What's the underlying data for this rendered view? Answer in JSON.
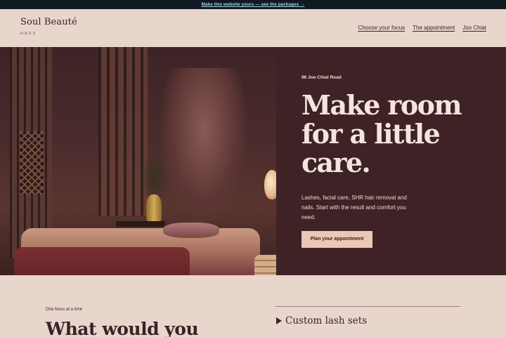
{
  "promo": {
    "text": "Make this website yours — see the packages →"
  },
  "brand": {
    "name": "Soul Beauté",
    "sub": "HAUS"
  },
  "nav": {
    "items": [
      {
        "label": "Choose your focus"
      },
      {
        "label": "The appointment"
      },
      {
        "label": "Joo Chiat"
      }
    ]
  },
  "hero": {
    "eyebrow": "96 Joo Chiat Road",
    "headline": "Make room for a little care.",
    "lede": "Lashes, facial care, SHR hair removal and nails. Start with the result and comfort you need.",
    "cta": "Plan your appointment"
  },
  "focus": {
    "eyebrow": "One focus at a time",
    "title": "What would you",
    "items": [
      {
        "label": "Custom lash sets",
        "icon": "triangle-right-icon"
      }
    ]
  },
  "colors": {
    "panel": "#3e2226",
    "background": "#e8d5cc",
    "cta": "#ecc7b5",
    "promo_bar": "#101820"
  }
}
